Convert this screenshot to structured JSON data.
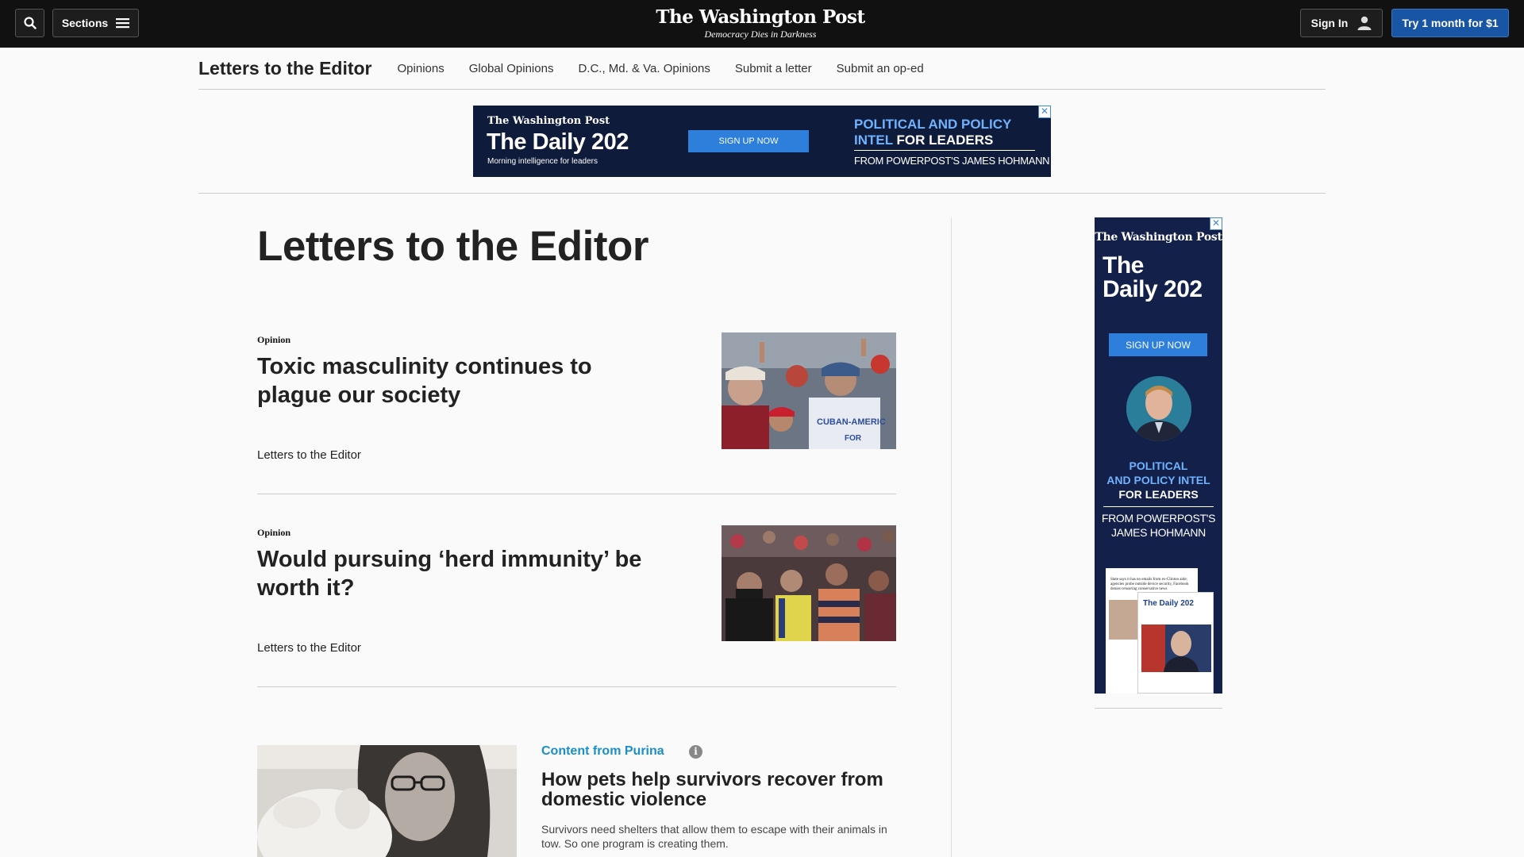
{
  "topbar": {
    "sections_label": "Sections",
    "logo_name": "The Washington Post",
    "logo_tagline": "Democracy Dies in Darkness",
    "signin_label": "Sign In",
    "subscribe_label": "Try 1 month for $1"
  },
  "subnav": {
    "title": "Letters to the Editor",
    "links": [
      "Opinions",
      "Global Opinions",
      "D.C., Md. & Va. Opinions",
      "Submit a letter",
      "Submit an op-ed"
    ]
  },
  "ad_top": {
    "brand": "The Washington Post",
    "product": "The Daily 202",
    "tagline": "Morning intelligence for leaders",
    "cta": "SIGN UP NOW",
    "headline_1": "POLITICAL AND POLICY",
    "headline_2a": "INTEL",
    "headline_2b": "FOR LEADERS",
    "footer": "FROM POWERPOST'S JAMES HOHMANN"
  },
  "main": {
    "page_title": "Letters to the Editor",
    "articles": [
      {
        "kicker": "Opinion",
        "headline": "Toxic masculinity continues to plague our society",
        "byline": "Letters to the Editor",
        "image_sign": "CUBAN-AMERIC",
        "image_sign_2": "FOR"
      },
      {
        "kicker": "Opinion",
        "headline": "Would pursuing ‘herd immunity’ be worth it?",
        "byline": "Letters to the Editor"
      }
    ],
    "sponsored": {
      "label": "Content from Purina",
      "headline": "How pets help survivors recover from domestic violence",
      "description": "Survivors need shelters that allow them to escape with their animals in tow. So one program is creating them."
    }
  },
  "ad_right": {
    "brand": "The Washington Post",
    "product_1": "The",
    "product_2": "Daily 202",
    "cta": "SIGN UP NOW",
    "line_1": "POLITICAL",
    "line_2": "AND POLICY INTEL",
    "line_3": "FOR LEADERS",
    "footer_1": "FROM POWERPOST'S",
    "footer_2": "JAMES HOHMANN",
    "mock_title": "The Daily 202",
    "mock_headline": "State says it has no emails from ex-Clinton aide; agencies probe outside device security, Facebook denies censoring conservative news"
  },
  "colors": {
    "accent_blue": "#1955a5",
    "sponsor_teal": "#1a8fc7",
    "ad_navy": "#0e1b3a",
    "ad_link_blue": "#6fb3ff"
  }
}
